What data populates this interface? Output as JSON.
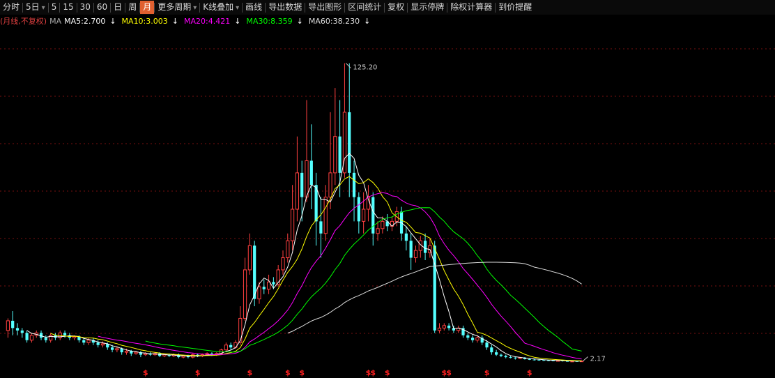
{
  "toolbar": {
    "items": [
      {
        "label": "分时",
        "active": false,
        "dropdown": false
      },
      {
        "label": "5日",
        "active": false,
        "dropdown": true
      },
      {
        "label": "5",
        "active": false,
        "dropdown": false
      },
      {
        "label": "15",
        "active": false,
        "dropdown": false
      },
      {
        "label": "30",
        "active": false,
        "dropdown": false
      },
      {
        "label": "60",
        "active": false,
        "dropdown": false
      },
      {
        "label": "日",
        "active": false,
        "dropdown": false
      },
      {
        "label": "周",
        "active": false,
        "dropdown": false
      },
      {
        "label": "月",
        "active": true,
        "dropdown": false
      },
      {
        "label": "更多周期",
        "active": false,
        "dropdown": true
      },
      {
        "label": "K线叠加",
        "active": false,
        "dropdown": true
      },
      {
        "label": "画线",
        "active": false,
        "dropdown": false
      },
      {
        "label": "导出数据",
        "active": false,
        "dropdown": false
      },
      {
        "label": "导出图形",
        "active": false,
        "dropdown": false
      },
      {
        "label": "区间统计",
        "active": false,
        "dropdown": false
      },
      {
        "label": "复权",
        "active": false,
        "dropdown": false
      },
      {
        "label": "显示停牌",
        "active": false,
        "dropdown": false
      },
      {
        "label": "除权计算器",
        "active": false,
        "dropdown": false
      },
      {
        "label": "到价提醒",
        "active": false,
        "dropdown": false
      }
    ]
  },
  "legend": {
    "period_label": "(月线,不复权)",
    "ma_label": "MA",
    "ma": [
      {
        "label": "MA5:2.700",
        "color": "#ffffff",
        "arrow": "↓"
      },
      {
        "label": "MA10:3.003",
        "color": "#ffff00",
        "arrow": "↓"
      },
      {
        "label": "MA20:4.421",
        "color": "#ff00ff",
        "arrow": "↓"
      },
      {
        "label": "MA30:8.359",
        "color": "#00ff00",
        "arrow": "↓"
      },
      {
        "label": "MA60:38.230",
        "color": "#dddddd",
        "arrow": "↓"
      }
    ]
  },
  "colors": {
    "up": "#ff4040",
    "down": "#54ffff",
    "grid": "#7a1010",
    "ma5": "#ffffff",
    "ma10": "#ffff00",
    "ma20": "#ff00ff",
    "ma30": "#00ff00",
    "ma60": "#dddddd"
  },
  "chart_data": {
    "type": "candlestick",
    "grid": true,
    "annotations": {
      "high_label": "125.20",
      "low_label": "2.17"
    },
    "ylim": [
      0,
      130
    ],
    "dividend_marker": "$",
    "candles": [
      [
        15.0,
        19.0,
        12.0,
        20.0
      ],
      [
        19.0,
        16.0,
        13.0,
        23.0
      ],
      [
        16.0,
        15.0,
        13.0,
        18.0
      ],
      [
        15.0,
        14.0,
        12.0,
        16.0
      ],
      [
        14.0,
        11.0,
        10.0,
        15.0
      ],
      [
        11.0,
        13.0,
        10.0,
        14.0
      ],
      [
        13.0,
        14.0,
        12.0,
        15.0
      ],
      [
        14.0,
        12.0,
        11.0,
        15.0
      ],
      [
        12.0,
        11.0,
        10.0,
        13.0
      ],
      [
        11.0,
        13.0,
        10.0,
        14.0
      ],
      [
        13.0,
        12.0,
        11.0,
        14.0
      ],
      [
        12.0,
        14.0,
        11.0,
        15.0
      ],
      [
        14.0,
        13.0,
        12.0,
        15.0
      ],
      [
        13.0,
        12.0,
        11.0,
        14.0
      ],
      [
        12.0,
        12.5,
        11.0,
        13.0
      ],
      [
        12.5,
        11.0,
        10.0,
        13.0
      ],
      [
        11.0,
        10.0,
        9.0,
        12.0
      ],
      [
        10.0,
        11.0,
        9.0,
        12.0
      ],
      [
        11.0,
        10.0,
        9.0,
        12.0
      ],
      [
        10.0,
        9.0,
        8.0,
        11.0
      ],
      [
        9.0,
        9.5,
        8.0,
        10.5
      ],
      [
        9.5,
        8.0,
        7.0,
        10.0
      ],
      [
        8.0,
        7.0,
        6.0,
        9.0
      ],
      [
        7.0,
        7.5,
        6.0,
        8.5
      ],
      [
        7.5,
        6.0,
        5.0,
        8.0
      ],
      [
        6.0,
        6.5,
        5.0,
        7.5
      ],
      [
        6.5,
        5.5,
        4.5,
        7.0
      ],
      [
        5.5,
        6.0,
        5.0,
        6.5
      ],
      [
        6.0,
        5.0,
        4.0,
        6.5
      ],
      [
        5.0,
        5.5,
        4.5,
        6.0
      ],
      [
        5.5,
        5.0,
        4.5,
        6.0
      ],
      [
        5.0,
        5.5,
        4.5,
        6.0
      ],
      [
        5.5,
        4.5,
        4.0,
        6.0
      ],
      [
        4.5,
        5.0,
        4.0,
        5.5
      ],
      [
        5.0,
        4.5,
        4.0,
        5.5
      ],
      [
        4.5,
        5.0,
        4.0,
        5.5
      ],
      [
        5.0,
        4.0,
        3.5,
        5.5
      ],
      [
        4.0,
        4.5,
        3.5,
        5.0
      ],
      [
        4.5,
        4.0,
        3.5,
        5.0
      ],
      [
        4.0,
        5.0,
        3.5,
        5.5
      ],
      [
        5.0,
        4.5,
        4.0,
        5.5
      ],
      [
        4.5,
        5.0,
        4.0,
        5.5
      ],
      [
        5.0,
        5.5,
        4.5,
        6.0
      ],
      [
        5.5,
        5.0,
        4.5,
        6.0
      ],
      [
        5.0,
        5.5,
        4.5,
        6.0
      ],
      [
        5.5,
        7.0,
        5.0,
        7.5
      ],
      [
        7.0,
        9.0,
        6.5,
        10.0
      ],
      [
        9.0,
        8.0,
        7.0,
        10.0
      ],
      [
        8.0,
        10.0,
        7.5,
        11.0
      ],
      [
        10.0,
        20.0,
        9.0,
        25.0
      ],
      [
        20.0,
        40.0,
        19.0,
        45.0
      ],
      [
        40.0,
        50.0,
        38.0,
        55.0
      ],
      [
        50.0,
        28.0,
        25.0,
        52.0
      ],
      [
        28.0,
        33.0,
        26.0,
        35.0
      ],
      [
        33.0,
        32.0,
        30.0,
        36.0
      ],
      [
        32.0,
        35.0,
        30.0,
        38.0
      ],
      [
        35.0,
        34.0,
        32.0,
        37.0
      ],
      [
        34.0,
        40.0,
        33.0,
        42.0
      ],
      [
        40.0,
        45.0,
        38.0,
        48.0
      ],
      [
        45.0,
        52.0,
        43.0,
        55.0
      ],
      [
        52.0,
        65.0,
        48.0,
        75.0
      ],
      [
        65.0,
        80.0,
        60.0,
        95.0
      ],
      [
        80.0,
        70.0,
        60.0,
        85.0
      ],
      [
        70.0,
        85.0,
        68.0,
        110.0
      ],
      [
        85.0,
        75.0,
        65.0,
        100.0
      ],
      [
        75.0,
        60.0,
        50.0,
        80.0
      ],
      [
        60.0,
        55.0,
        45.0,
        70.0
      ],
      [
        55.0,
        70.0,
        52.0,
        75.0
      ],
      [
        70.0,
        80.0,
        65.0,
        105.0
      ],
      [
        80.0,
        95.0,
        75.0,
        115.0
      ],
      [
        95.0,
        80.0,
        70.0,
        110.0
      ],
      [
        80.0,
        105.0,
        78.0,
        125.2
      ],
      [
        105.0,
        80.0,
        70.0,
        125.2
      ],
      [
        80.0,
        70.0,
        60.0,
        85.0
      ],
      [
        70.0,
        60.0,
        55.0,
        72.0
      ],
      [
        60.0,
        65.0,
        55.0,
        72.0
      ],
      [
        65.0,
        70.0,
        60.0,
        75.0
      ],
      [
        70.0,
        55.0,
        50.0,
        72.0
      ],
      [
        55.0,
        57.0,
        52.0,
        60.0
      ],
      [
        57.0,
        60.0,
        55.0,
        62.0
      ],
      [
        60.0,
        58.0,
        56.0,
        63.0
      ],
      [
        58.0,
        60.0,
        56.0,
        62.0
      ],
      [
        60.0,
        64.0,
        58.0,
        66.0
      ],
      [
        64.0,
        55.0,
        52.0,
        66.0
      ],
      [
        55.0,
        52.0,
        48.0,
        58.0
      ],
      [
        52.0,
        45.0,
        40.0,
        55.0
      ],
      [
        45.0,
        48.0,
        43.0,
        50.0
      ],
      [
        48.0,
        52.0,
        45.0,
        54.0
      ],
      [
        52.0,
        47.0,
        44.0,
        55.0
      ],
      [
        47.0,
        50.0,
        45.0,
        53.0
      ],
      [
        50.0,
        15.0,
        14.0,
        52.0
      ],
      [
        15.0,
        16.0,
        14.0,
        18.0
      ],
      [
        16.0,
        17.0,
        15.0,
        18.0
      ],
      [
        17.0,
        16.0,
        15.0,
        18.0
      ],
      [
        16.0,
        15.0,
        14.0,
        17.0
      ],
      [
        15.0,
        16.0,
        14.0,
        17.0
      ],
      [
        16.0,
        13.0,
        12.0,
        17.0
      ],
      [
        13.0,
        12.0,
        11.0,
        14.0
      ],
      [
        12.0,
        11.0,
        10.0,
        13.0
      ],
      [
        11.0,
        12.0,
        10.0,
        13.0
      ],
      [
        12.0,
        10.0,
        9.0,
        13.0
      ],
      [
        10.0,
        8.0,
        7.0,
        11.0
      ],
      [
        8.0,
        6.0,
        5.0,
        9.0
      ],
      [
        6.0,
        5.0,
        4.5,
        7.0
      ],
      [
        5.0,
        4.5,
        4.0,
        5.5
      ],
      [
        4.5,
        4.0,
        3.5,
        5.0
      ],
      [
        4.0,
        3.8,
        3.5,
        4.5
      ],
      [
        3.8,
        3.5,
        3.0,
        4.2
      ],
      [
        3.5,
        3.8,
        3.2,
        4.0
      ],
      [
        3.8,
        3.2,
        3.0,
        4.0
      ],
      [
        3.2,
        3.0,
        2.8,
        3.5
      ],
      [
        3.0,
        2.9,
        2.6,
        3.3
      ],
      [
        2.9,
        2.8,
        2.5,
        3.1
      ],
      [
        2.8,
        2.7,
        2.4,
        3.0
      ],
      [
        2.7,
        2.6,
        2.3,
        2.9
      ],
      [
        2.6,
        2.5,
        2.3,
        2.8
      ],
      [
        2.5,
        2.6,
        2.3,
        2.8
      ],
      [
        2.6,
        2.4,
        2.2,
        2.7
      ],
      [
        2.4,
        2.3,
        2.2,
        2.6
      ],
      [
        2.3,
        2.35,
        2.2,
        2.5
      ],
      [
        2.35,
        2.3,
        2.17,
        2.5
      ],
      [
        2.3,
        2.4,
        2.17,
        2.5
      ]
    ],
    "dividend_indices": [
      29,
      40,
      51,
      59,
      62,
      76,
      77,
      80,
      92,
      93,
      101,
      110
    ]
  }
}
